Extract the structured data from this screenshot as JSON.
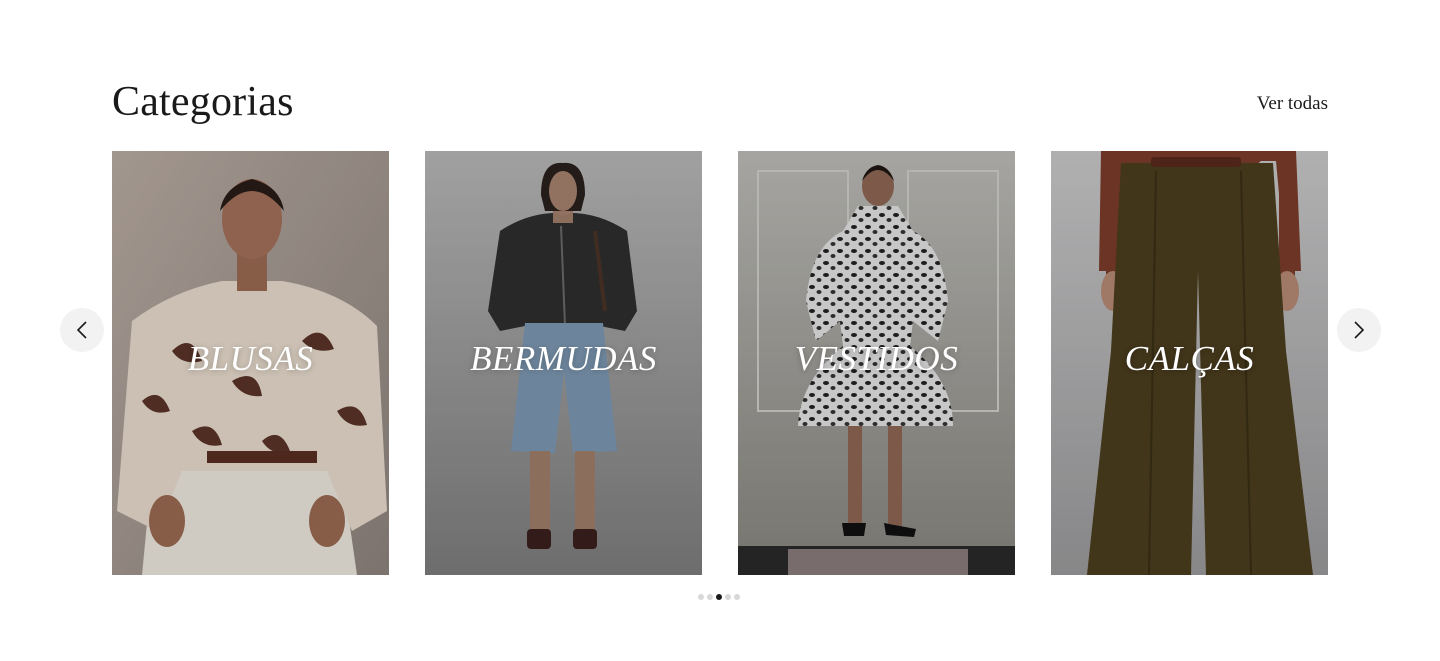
{
  "section": {
    "title": "Categorias",
    "view_all": "Ver todas"
  },
  "categories": [
    {
      "label": "BLUSAS"
    },
    {
      "label": "BERMUDAS"
    },
    {
      "label": "VESTIDOS"
    },
    {
      "label": "CALÇAS"
    }
  ],
  "carousel": {
    "prev_icon": "chevron-left-icon",
    "next_icon": "chevron-right-icon",
    "dot_count": 5,
    "active_dot": 3
  },
  "colors": {
    "text": "#1a1a1a",
    "nav_bg": "#f2f2f2",
    "dot_inactive": "#d8d8d8",
    "dot_active": "#1a1a1a"
  }
}
